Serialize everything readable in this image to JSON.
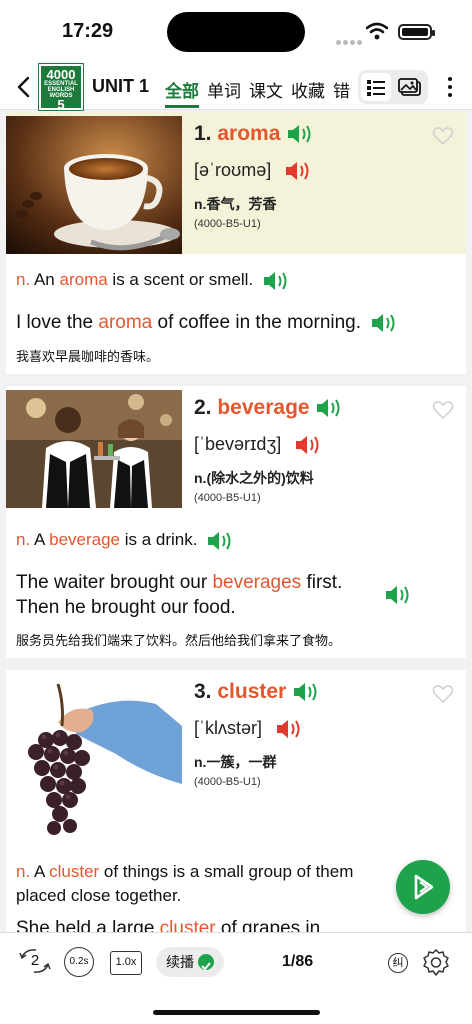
{
  "status": {
    "time": "17:29"
  },
  "nav": {
    "logo": {
      "top": "4000",
      "mid": "ESSENTIAL ENGLISH WORDS",
      "num": "5"
    },
    "unit": "UNIT 1",
    "tabs": [
      "全部",
      "单词",
      "课文",
      "收藏",
      "错词"
    ]
  },
  "words": [
    {
      "num": "1.",
      "word": "aroma",
      "ipa": "[əˈroʊmə]",
      "pos_meaning": "n.香气，芳香",
      "code": "(4000-B5-U1)",
      "def_pos": "n.",
      "def_pre": " An ",
      "def_word": "aroma",
      "def_post": " is a scent or smell.",
      "ex_pre": "I love the ",
      "ex_word": "aroma",
      "ex_post": " of coffee in the morning.",
      "zh": "我喜欢早晨咖啡的香味。",
      "image": "coffee-cup-photo"
    },
    {
      "num": "2.",
      "word": "beverage",
      "ipa": "[ˈbevərɪdʒ]",
      "pos_meaning": "n.(除水之外的)饮料",
      "code": "(4000-B5-U1)",
      "def_pos": "n.",
      "def_pre": " A ",
      "def_word": "beverage",
      "def_post": " is a drink.",
      "ex_pre": "The waiter brought our ",
      "ex_word": "beverages",
      "ex_post": " first.",
      "ex_line2": "Then he brought our food.",
      "zh": "服务员先给我们端来了饮料。然后他给我们拿来了食物。",
      "image": "waiters-photo"
    },
    {
      "num": "3.",
      "word": "cluster",
      "ipa": "[ˈklʌstər]",
      "pos_meaning": "n.一簇，一群",
      "code": "(4000-B5-U1)",
      "def_pos": "n.",
      "def_pre": " A ",
      "def_word": "cluster",
      "def_post": " of things is a small group of them",
      "def_line2": "placed close together.",
      "ex_pre": "She held a large ",
      "ex_word": "cluster",
      "ex_post": " of grapes in",
      "image": "grapes-photo"
    }
  ],
  "bottom": {
    "repeat": "2",
    "interval": "0.2s",
    "speed": "1.0x",
    "autoplay": "续播",
    "pager": "1/86",
    "correct": "纠"
  },
  "colors": {
    "accent": "#1d7a3b",
    "highlight": "#e4572e",
    "speaker_green": "#1ea34a",
    "speaker_red": "#e23b2e"
  }
}
